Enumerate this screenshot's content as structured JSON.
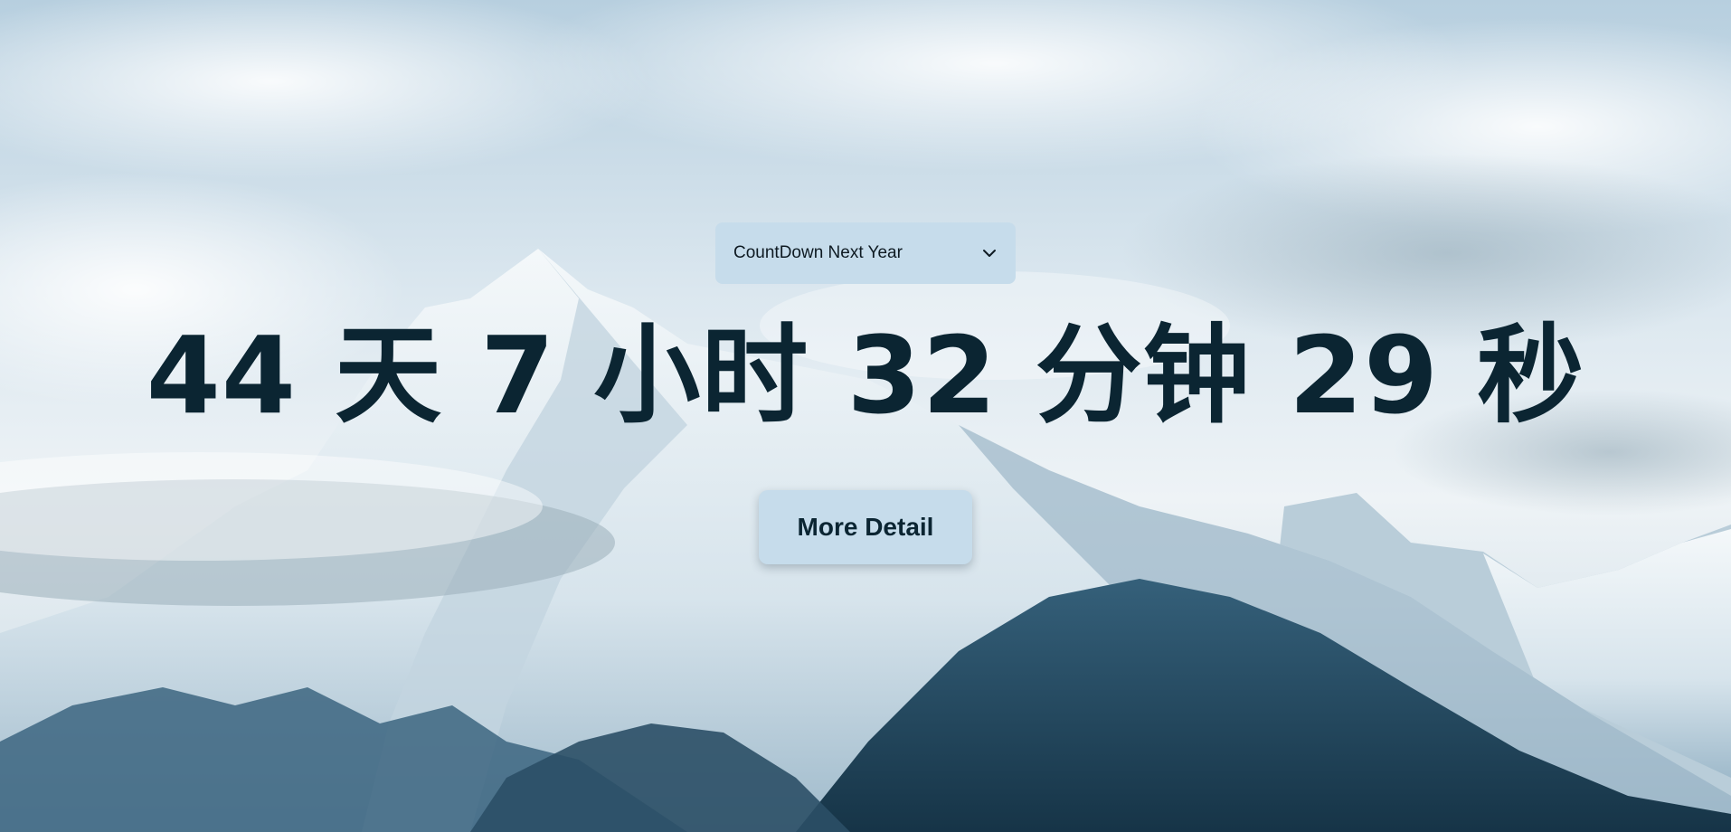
{
  "selector": {
    "label": "CountDown Next Year",
    "icon": "chevron-down-icon"
  },
  "countdown": {
    "days": "44",
    "days_unit": "天",
    "hours": "7",
    "hours_unit": "小时",
    "minutes": "32",
    "minutes_unit": "分钟",
    "seconds": "29",
    "seconds_unit": "秒"
  },
  "actions": {
    "more_detail_label": "More Detail"
  },
  "colors": {
    "accent_panel": "#c6dceb",
    "text_dark": "#0b2532"
  }
}
